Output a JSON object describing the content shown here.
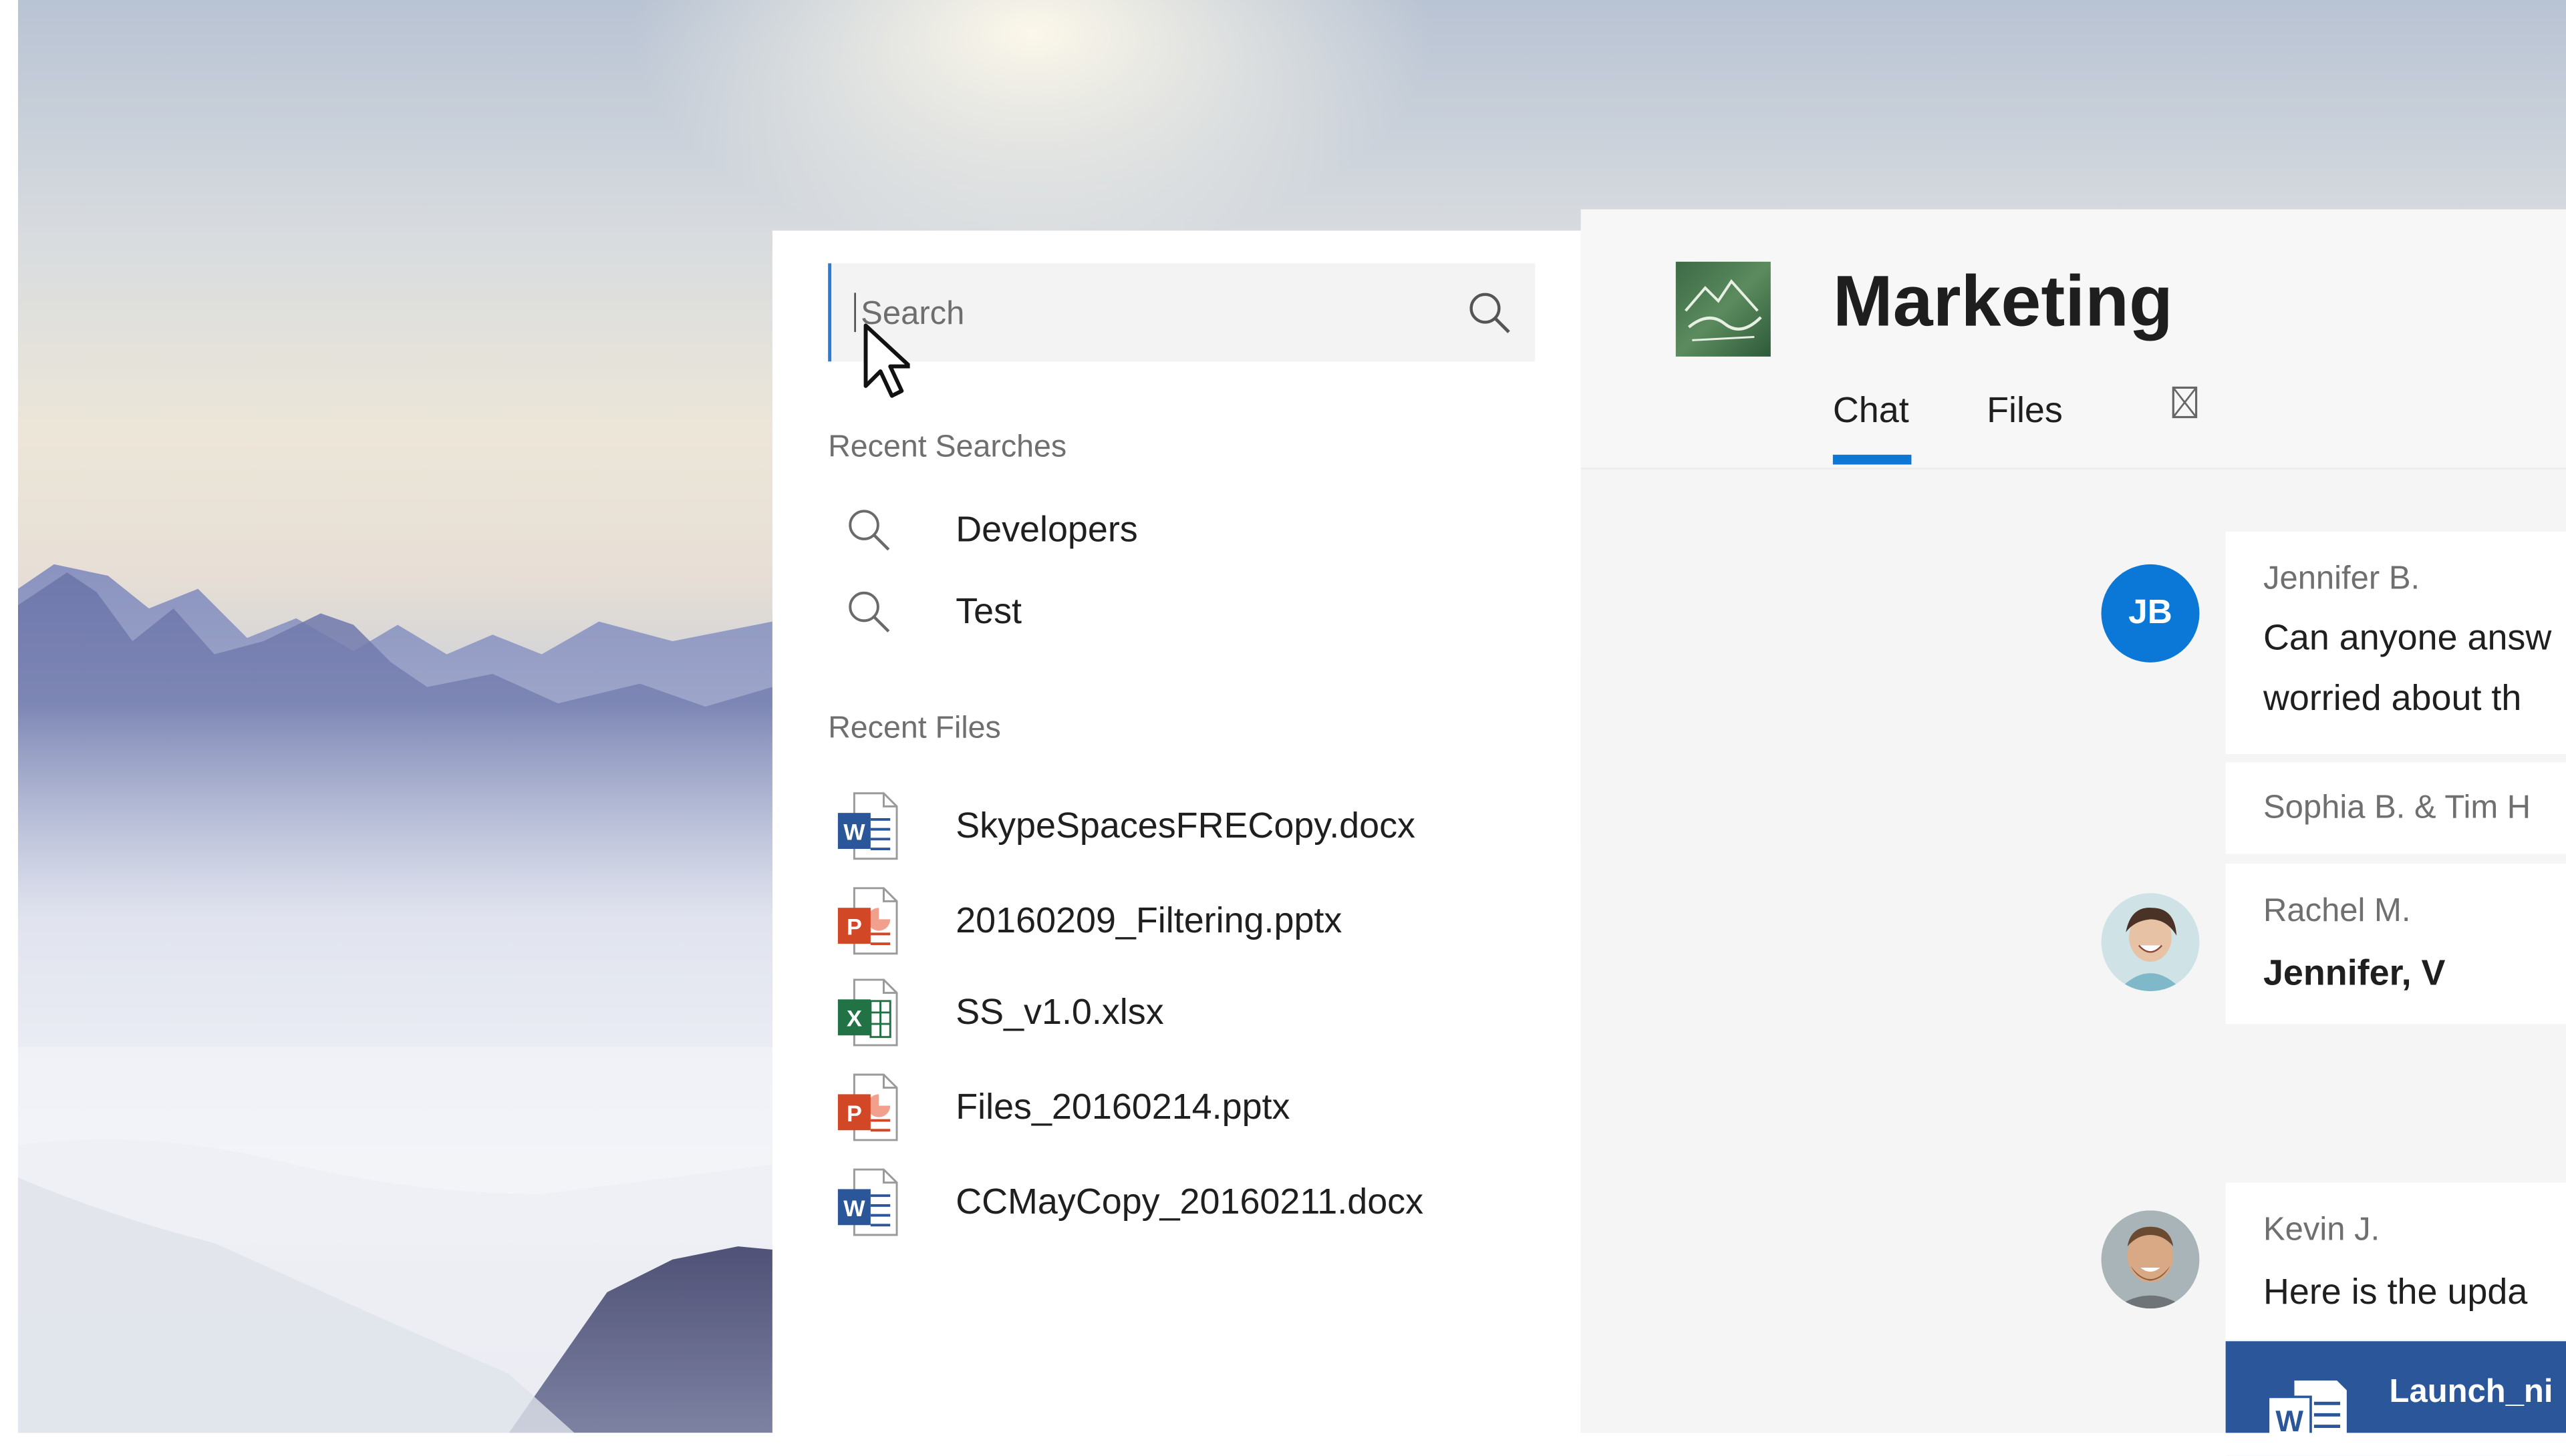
{
  "search": {
    "placeholder": "Search",
    "button_icon": "search-icon"
  },
  "recent_searches": {
    "label": "Recent Searches",
    "items": [
      {
        "text": "Developers",
        "icon": "search-icon"
      },
      {
        "text": "Test",
        "icon": "search-icon"
      }
    ]
  },
  "recent_files": {
    "label": "Recent Files",
    "items": [
      {
        "name": "SkypeSpacesFRECopy.docx",
        "type": "word",
        "icon": "word-doc-icon"
      },
      {
        "name": "20160209_Filtering.pptx",
        "type": "powerpoint",
        "icon": "powerpoint-doc-icon"
      },
      {
        "name": "SS_v1.0.xlsx",
        "type": "excel",
        "icon": "excel-doc-icon"
      },
      {
        "name": "Files_20160214.pptx",
        "type": "powerpoint",
        "icon": "powerpoint-doc-icon"
      },
      {
        "name": "CCMayCopy_20160211.docx",
        "type": "word",
        "icon": "word-doc-icon"
      }
    ]
  },
  "channel": {
    "title": "Marketing",
    "tabs": [
      {
        "label": "Chat",
        "active": true
      },
      {
        "label": "Files",
        "active": false
      }
    ],
    "extra_tab_icon": "broken-image-icon"
  },
  "messages": [
    {
      "author": "Jennifer B.",
      "initials": "JB",
      "lines": [
        "Can anyone answ",
        "worried about th"
      ]
    },
    {
      "author": "Sophia B. & Tim H",
      "lines": []
    },
    {
      "author": "Rachel M.",
      "lines": [
        "Jennifer, V"
      ]
    },
    {
      "author": "Kevin J.",
      "lines": [
        "Here is the upda"
      ]
    }
  ],
  "attachment": {
    "name": "Launch_ni",
    "icon": "word-doc-icon"
  },
  "colors": {
    "accent": "#0b78d7",
    "word": "#2b579a",
    "powerpoint": "#d24726",
    "excel": "#217346"
  }
}
